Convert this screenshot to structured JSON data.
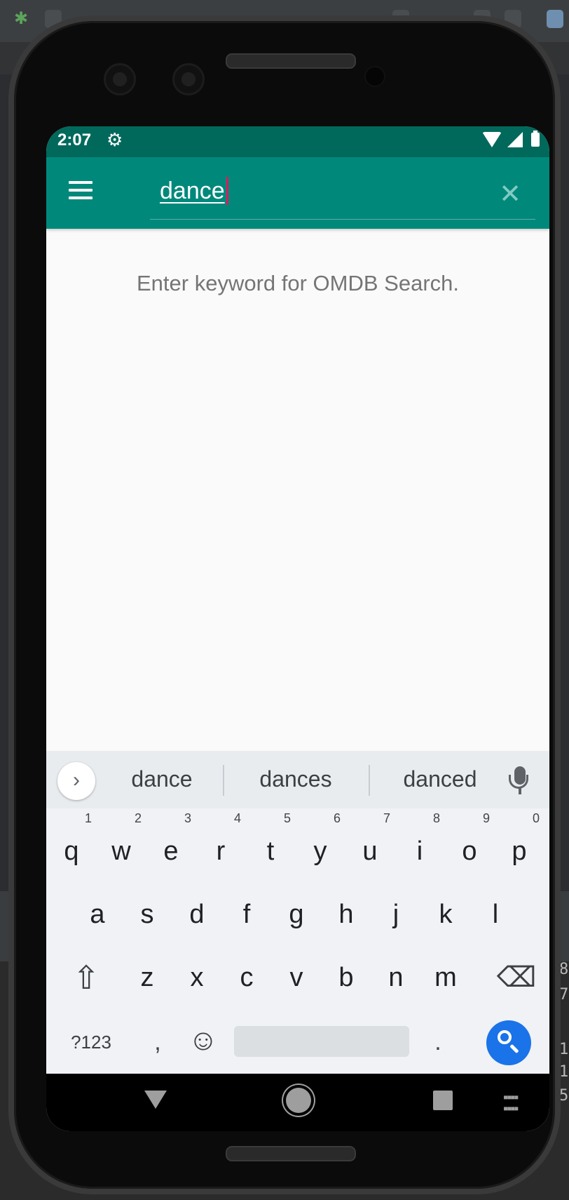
{
  "status_bar": {
    "time": "2:07",
    "gear_icon": "⚙"
  },
  "app_bar": {
    "menu_icon": "hamburger-menu",
    "search_value": "dance",
    "clear_icon": "✕"
  },
  "content": {
    "hint": "Enter keyword for OMDB Search."
  },
  "keyboard": {
    "suggestions": [
      "dance",
      "dances",
      "danced"
    ],
    "expand_icon": "›",
    "row1": [
      {
        "key": "q",
        "hint": "1"
      },
      {
        "key": "w",
        "hint": "2"
      },
      {
        "key": "e",
        "hint": "3"
      },
      {
        "key": "r",
        "hint": "4"
      },
      {
        "key": "t",
        "hint": "5"
      },
      {
        "key": "y",
        "hint": "6"
      },
      {
        "key": "u",
        "hint": "7"
      },
      {
        "key": "i",
        "hint": "8"
      },
      {
        "key": "o",
        "hint": "9"
      },
      {
        "key": "p",
        "hint": "0"
      }
    ],
    "row2": [
      "a",
      "s",
      "d",
      "f",
      "g",
      "h",
      "j",
      "k",
      "l"
    ],
    "row3": [
      "z",
      "x",
      "c",
      "v",
      "b",
      "n",
      "m"
    ],
    "symbols_label": "?123",
    "comma_label": ",",
    "period_label": ".",
    "shift_icon": "⇧",
    "backspace_icon": "⌫",
    "emoji_icon": "☺"
  },
  "colors": {
    "status_bar": "#00695c",
    "app_bar": "#00897b",
    "caret": "#d81b60",
    "search_key": "#1a73e8"
  },
  "ide_side_text": [
    "8",
    "7",
    "1",
    "1",
    "5"
  ]
}
